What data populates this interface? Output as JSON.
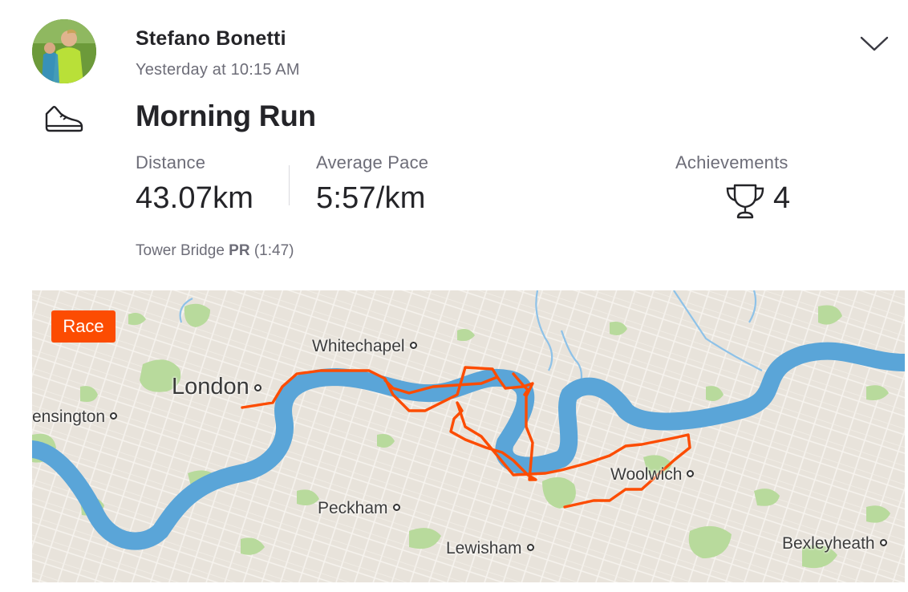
{
  "athlete": {
    "name": "Stefano Bonetti",
    "timestamp": "Yesterday at 10:15 AM"
  },
  "activity": {
    "title": "Morning Run",
    "sport_icon": "running-shoe-icon"
  },
  "stats": {
    "distance_label": "Distance",
    "distance_value": "43.07km",
    "pace_label": "Average Pace",
    "pace_value": "5:57/km",
    "achievements_label": "Achievements",
    "achievements_value": "4"
  },
  "segment": {
    "name": "Tower Bridge",
    "badge": "PR",
    "time": "(1:47)"
  },
  "map": {
    "badge": "Race",
    "places": {
      "whitechapel": "Whitechapel",
      "london": "London",
      "kensington": "ensington",
      "woolwich": "Woolwich",
      "peckham": "Peckham",
      "lewisham": "Lewisham",
      "bexleyheath": "Bexleyheath"
    },
    "route_color": "#fc4c02",
    "river_color": "#5aa5d8",
    "park_color": "#b7d99c"
  }
}
